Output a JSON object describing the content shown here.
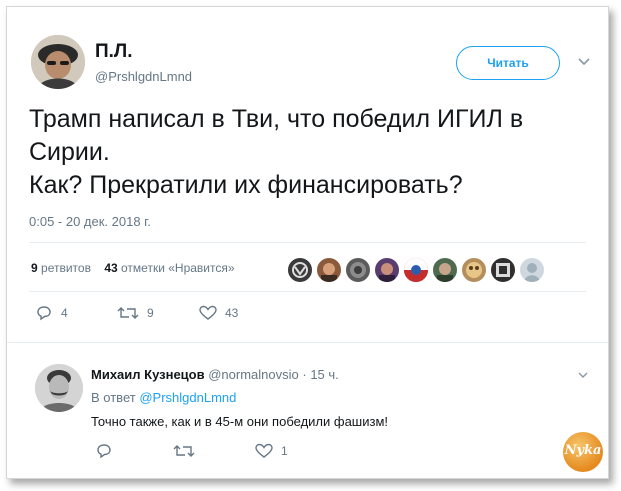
{
  "tweet": {
    "author_name": "П.Л.",
    "author_handle": "@PrshlgdnLmnd",
    "follow_label": "Читать",
    "text_lines": [
      "Трамп написал в Тви, что победил ИГИЛ в",
      "Сирии.",
      "Как? Прекратили их финансировать?"
    ],
    "timestamp": "0:05 - 20 дек. 2018 г.",
    "retweets_count": "9",
    "retweets_label": "ретвитов",
    "likes_count": "43",
    "likes_label": "отметки «Нравится»",
    "actions": {
      "reply_count": "4",
      "retweet_count": "9",
      "like_count": "43"
    }
  },
  "reply": {
    "author_name": "Михаил Кузнецов",
    "author_handle": "@normalnovsio",
    "time": "· 15 ч.",
    "in_reply_prefix": "В ответ",
    "in_reply_handle": "@PrshlgdnLmnd",
    "text": "Точно также, как и в 45-м они победили фашизм!",
    "actions": {
      "reply_count": "",
      "retweet_count": "",
      "like_count": "1"
    }
  },
  "watermark": {
    "text": "Nyka"
  },
  "colors": {
    "accent": "#1da1f2",
    "secondary_text": "#657786",
    "primary_text": "#14171a",
    "divider": "#e6ecf0"
  },
  "icons": [
    "chevron-down-icon",
    "reply-icon",
    "retweet-icon",
    "heart-icon"
  ]
}
